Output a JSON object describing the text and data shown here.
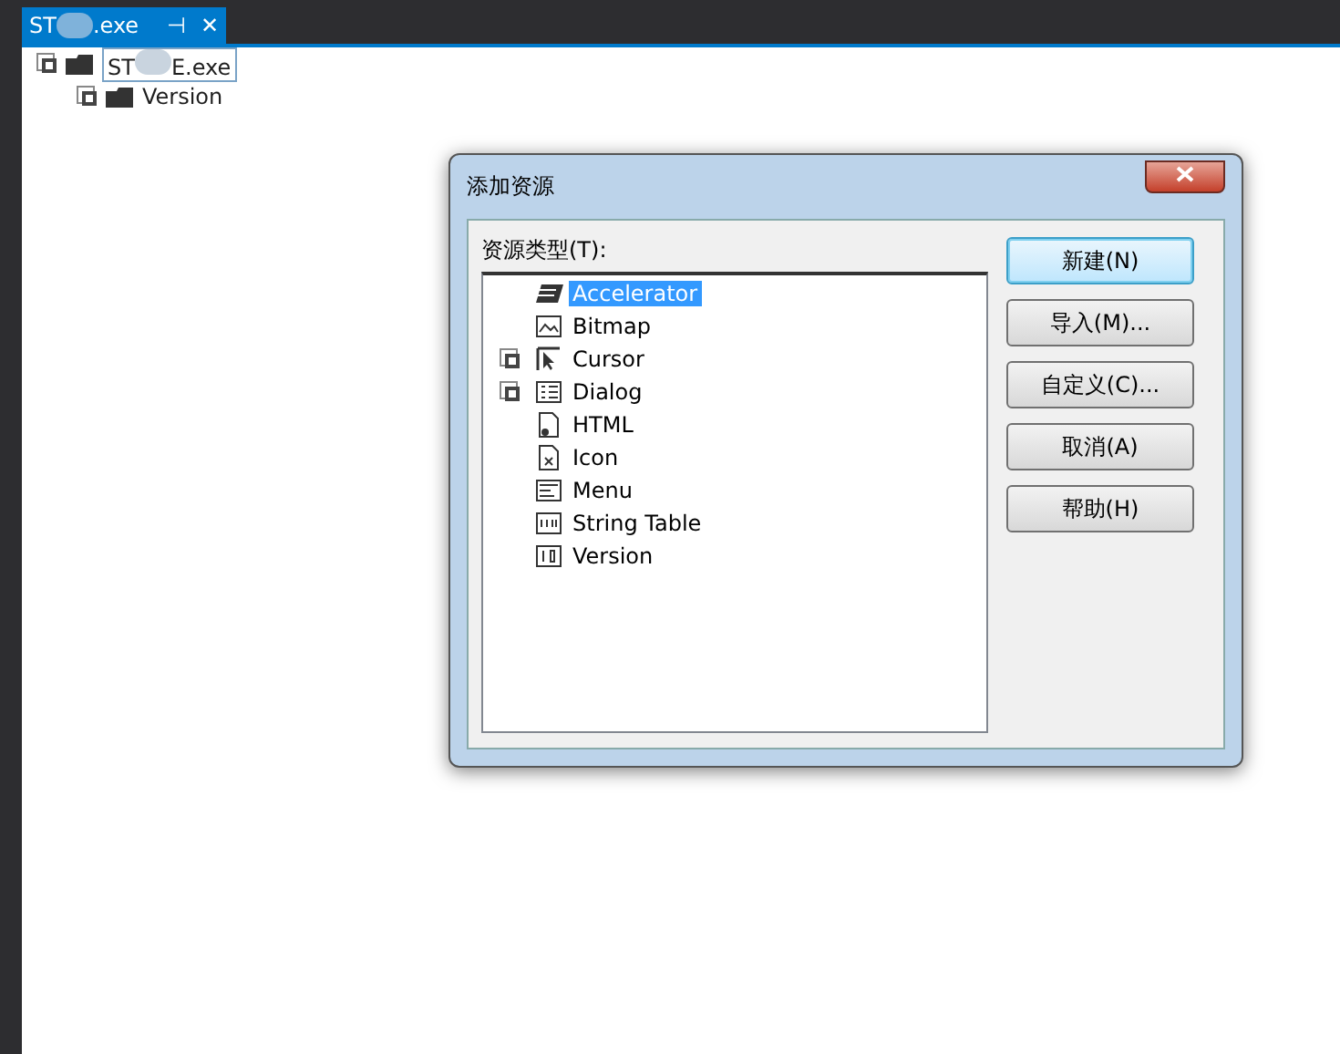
{
  "document_tab": {
    "title_start": "ST",
    "title_end": ".exe",
    "pin": "⊣",
    "close": "✕"
  },
  "tree": {
    "root": {
      "label_start": "ST",
      "label_end": "E.exe",
      "children": [
        {
          "label": "Version"
        }
      ]
    }
  },
  "dialog": {
    "title": "添加资源",
    "list_label": "资源类型(T):",
    "items": [
      {
        "label": "Accelerator",
        "selected": true,
        "has_children": false
      },
      {
        "label": "Bitmap",
        "selected": false,
        "has_children": false
      },
      {
        "label": "Cursor",
        "selected": false,
        "has_children": true
      },
      {
        "label": "Dialog",
        "selected": false,
        "has_children": true
      },
      {
        "label": "HTML",
        "selected": false,
        "has_children": false
      },
      {
        "label": "Icon",
        "selected": false,
        "has_children": false
      },
      {
        "label": "Menu",
        "selected": false,
        "has_children": false
      },
      {
        "label": "String Table",
        "selected": false,
        "has_children": false
      },
      {
        "label": "Version",
        "selected": false,
        "has_children": false
      }
    ],
    "buttons": [
      {
        "label": "新建(N)",
        "default": true
      },
      {
        "label": "导入(M)...",
        "default": false
      },
      {
        "label": "自定义(C)...",
        "default": false
      },
      {
        "label": "取消(A)",
        "default": false
      },
      {
        "label": "帮助(H)",
        "default": false
      }
    ]
  }
}
